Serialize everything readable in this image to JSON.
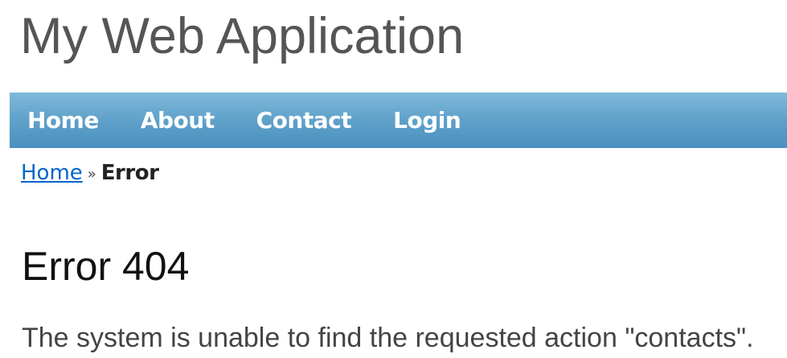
{
  "header": {
    "title": "My Web Application"
  },
  "mainmenu": {
    "items": [
      {
        "label": "Home"
      },
      {
        "label": "About"
      },
      {
        "label": "Contact"
      },
      {
        "label": "Login"
      }
    ]
  },
  "breadcrumb": {
    "home": "Home",
    "separator": "»",
    "current": "Error"
  },
  "content": {
    "heading": "Error 404",
    "message": "The system is unable to find the requested action \"contacts\"."
  },
  "colors": {
    "menu_bar": "#5fa1ca",
    "link": "#0066cc",
    "title": "#555555"
  }
}
